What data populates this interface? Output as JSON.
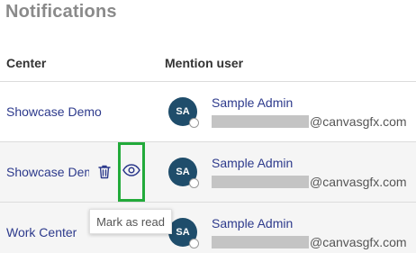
{
  "page": {
    "title": "Notifications"
  },
  "table": {
    "headers": {
      "center": "Center",
      "mention": "Mention user"
    },
    "rows": [
      {
        "center": "Showcase Demo",
        "avatar": "SA",
        "user_name": "Sample Admin",
        "email_domain": "@canvasgfx.com"
      },
      {
        "center": "Showcase Demo",
        "avatar": "SA",
        "user_name": "Sample Admin",
        "email_domain": "@canvasgfx.com"
      },
      {
        "center": "Work Center",
        "avatar": "SA",
        "user_name": "Sample Admin",
        "email_domain": "@canvasgfx.com"
      }
    ]
  },
  "tooltip": {
    "text": "Mark as read"
  },
  "icons": {
    "delete": "trash-icon",
    "read": "eye-icon"
  },
  "colors": {
    "link": "#2d3a8c",
    "avatar": "#1f4d6b",
    "highlight": "#22aa3a"
  }
}
